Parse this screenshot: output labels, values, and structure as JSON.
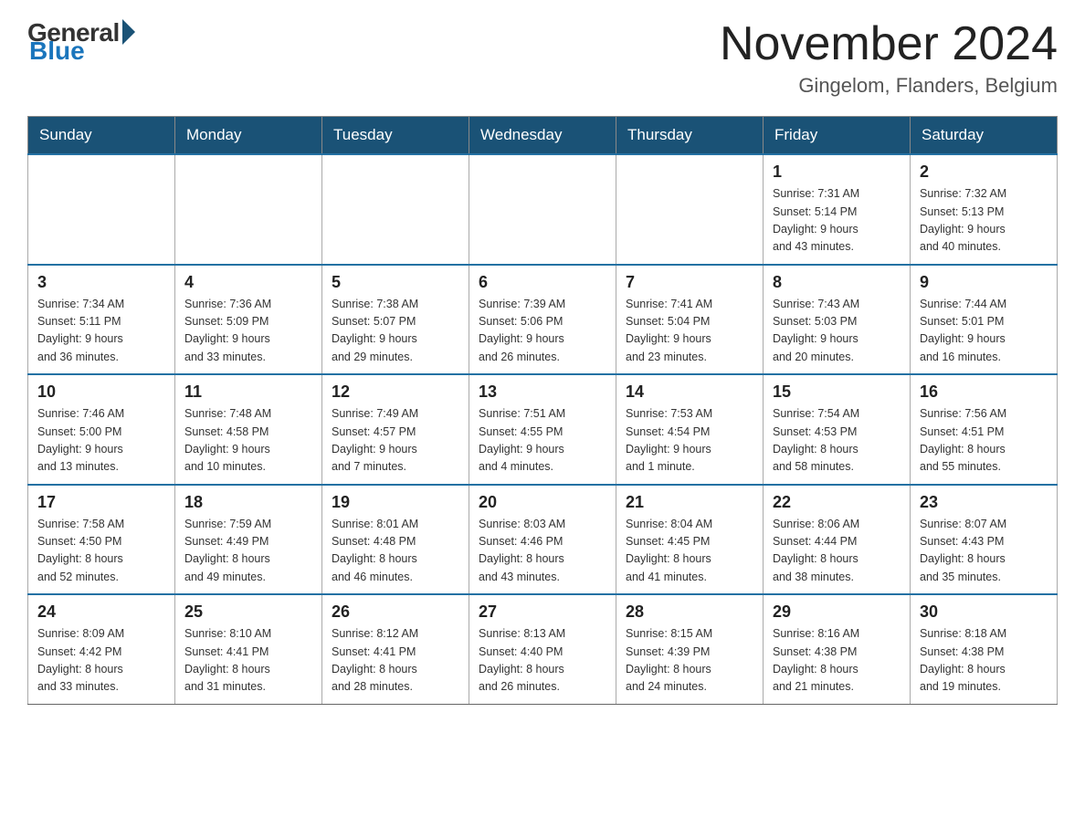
{
  "header": {
    "logo": {
      "general": "General",
      "blue": "Blue"
    },
    "title": "November 2024",
    "subtitle": "Gingelom, Flanders, Belgium"
  },
  "days_of_week": [
    "Sunday",
    "Monday",
    "Tuesday",
    "Wednesday",
    "Thursday",
    "Friday",
    "Saturday"
  ],
  "weeks": [
    [
      {
        "day": "",
        "info": ""
      },
      {
        "day": "",
        "info": ""
      },
      {
        "day": "",
        "info": ""
      },
      {
        "day": "",
        "info": ""
      },
      {
        "day": "",
        "info": ""
      },
      {
        "day": "1",
        "info": "Sunrise: 7:31 AM\nSunset: 5:14 PM\nDaylight: 9 hours\nand 43 minutes."
      },
      {
        "day": "2",
        "info": "Sunrise: 7:32 AM\nSunset: 5:13 PM\nDaylight: 9 hours\nand 40 minutes."
      }
    ],
    [
      {
        "day": "3",
        "info": "Sunrise: 7:34 AM\nSunset: 5:11 PM\nDaylight: 9 hours\nand 36 minutes."
      },
      {
        "day": "4",
        "info": "Sunrise: 7:36 AM\nSunset: 5:09 PM\nDaylight: 9 hours\nand 33 minutes."
      },
      {
        "day": "5",
        "info": "Sunrise: 7:38 AM\nSunset: 5:07 PM\nDaylight: 9 hours\nand 29 minutes."
      },
      {
        "day": "6",
        "info": "Sunrise: 7:39 AM\nSunset: 5:06 PM\nDaylight: 9 hours\nand 26 minutes."
      },
      {
        "day": "7",
        "info": "Sunrise: 7:41 AM\nSunset: 5:04 PM\nDaylight: 9 hours\nand 23 minutes."
      },
      {
        "day": "8",
        "info": "Sunrise: 7:43 AM\nSunset: 5:03 PM\nDaylight: 9 hours\nand 20 minutes."
      },
      {
        "day": "9",
        "info": "Sunrise: 7:44 AM\nSunset: 5:01 PM\nDaylight: 9 hours\nand 16 minutes."
      }
    ],
    [
      {
        "day": "10",
        "info": "Sunrise: 7:46 AM\nSunset: 5:00 PM\nDaylight: 9 hours\nand 13 minutes."
      },
      {
        "day": "11",
        "info": "Sunrise: 7:48 AM\nSunset: 4:58 PM\nDaylight: 9 hours\nand 10 minutes."
      },
      {
        "day": "12",
        "info": "Sunrise: 7:49 AM\nSunset: 4:57 PM\nDaylight: 9 hours\nand 7 minutes."
      },
      {
        "day": "13",
        "info": "Sunrise: 7:51 AM\nSunset: 4:55 PM\nDaylight: 9 hours\nand 4 minutes."
      },
      {
        "day": "14",
        "info": "Sunrise: 7:53 AM\nSunset: 4:54 PM\nDaylight: 9 hours\nand 1 minute."
      },
      {
        "day": "15",
        "info": "Sunrise: 7:54 AM\nSunset: 4:53 PM\nDaylight: 8 hours\nand 58 minutes."
      },
      {
        "day": "16",
        "info": "Sunrise: 7:56 AM\nSunset: 4:51 PM\nDaylight: 8 hours\nand 55 minutes."
      }
    ],
    [
      {
        "day": "17",
        "info": "Sunrise: 7:58 AM\nSunset: 4:50 PM\nDaylight: 8 hours\nand 52 minutes."
      },
      {
        "day": "18",
        "info": "Sunrise: 7:59 AM\nSunset: 4:49 PM\nDaylight: 8 hours\nand 49 minutes."
      },
      {
        "day": "19",
        "info": "Sunrise: 8:01 AM\nSunset: 4:48 PM\nDaylight: 8 hours\nand 46 minutes."
      },
      {
        "day": "20",
        "info": "Sunrise: 8:03 AM\nSunset: 4:46 PM\nDaylight: 8 hours\nand 43 minutes."
      },
      {
        "day": "21",
        "info": "Sunrise: 8:04 AM\nSunset: 4:45 PM\nDaylight: 8 hours\nand 41 minutes."
      },
      {
        "day": "22",
        "info": "Sunrise: 8:06 AM\nSunset: 4:44 PM\nDaylight: 8 hours\nand 38 minutes."
      },
      {
        "day": "23",
        "info": "Sunrise: 8:07 AM\nSunset: 4:43 PM\nDaylight: 8 hours\nand 35 minutes."
      }
    ],
    [
      {
        "day": "24",
        "info": "Sunrise: 8:09 AM\nSunset: 4:42 PM\nDaylight: 8 hours\nand 33 minutes."
      },
      {
        "day": "25",
        "info": "Sunrise: 8:10 AM\nSunset: 4:41 PM\nDaylight: 8 hours\nand 31 minutes."
      },
      {
        "day": "26",
        "info": "Sunrise: 8:12 AM\nSunset: 4:41 PM\nDaylight: 8 hours\nand 28 minutes."
      },
      {
        "day": "27",
        "info": "Sunrise: 8:13 AM\nSunset: 4:40 PM\nDaylight: 8 hours\nand 26 minutes."
      },
      {
        "day": "28",
        "info": "Sunrise: 8:15 AM\nSunset: 4:39 PM\nDaylight: 8 hours\nand 24 minutes."
      },
      {
        "day": "29",
        "info": "Sunrise: 8:16 AM\nSunset: 4:38 PM\nDaylight: 8 hours\nand 21 minutes."
      },
      {
        "day": "30",
        "info": "Sunrise: 8:18 AM\nSunset: 4:38 PM\nDaylight: 8 hours\nand 19 minutes."
      }
    ]
  ]
}
